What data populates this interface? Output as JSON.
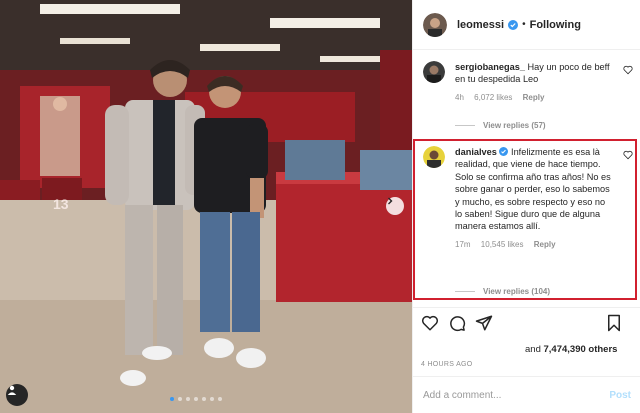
{
  "post": {
    "username": "leomessi",
    "separator": "•",
    "follow_status": "Following",
    "jersey_number": "13",
    "carousel_dot_count": 7,
    "carousel_active_index": 0
  },
  "comments": [
    {
      "username": "sergiobanegas_",
      "text": "Hay un poco de beff en tu despedida Leo",
      "time": "4h",
      "likes": "6,072 likes",
      "reply_label": "Reply",
      "view_replies": "View replies (57)"
    },
    {
      "username": "danialves",
      "text": "Infelizmente es esa là realidad, que viene de hace tiempo. Solo se confirma año tras años! No es sobre ganar o perder, eso lo sabemos y mucho, es sobre respecto y eso no lo saben! Sigue duro que de alguna manera estamos allí.",
      "time": "17m",
      "likes": "10,545 likes",
      "reply_label": "Reply",
      "view_replies": "View replies (104)"
    }
  ],
  "likes_line": {
    "prefix": "and",
    "count": "7,474,390 others"
  },
  "timestamp": "4 HOURS AGO",
  "add_comment": {
    "placeholder": "Add a comment...",
    "post_label": "Post"
  },
  "colors": {
    "highlight": "#d1202f",
    "verified": "#3897f0",
    "post_disabled": "#b2dffc"
  },
  "icons": [
    "heart-icon",
    "comment-icon",
    "share-icon",
    "bookmark-icon",
    "chevron-right-icon",
    "tag-user-icon",
    "verified-badge-icon"
  ]
}
